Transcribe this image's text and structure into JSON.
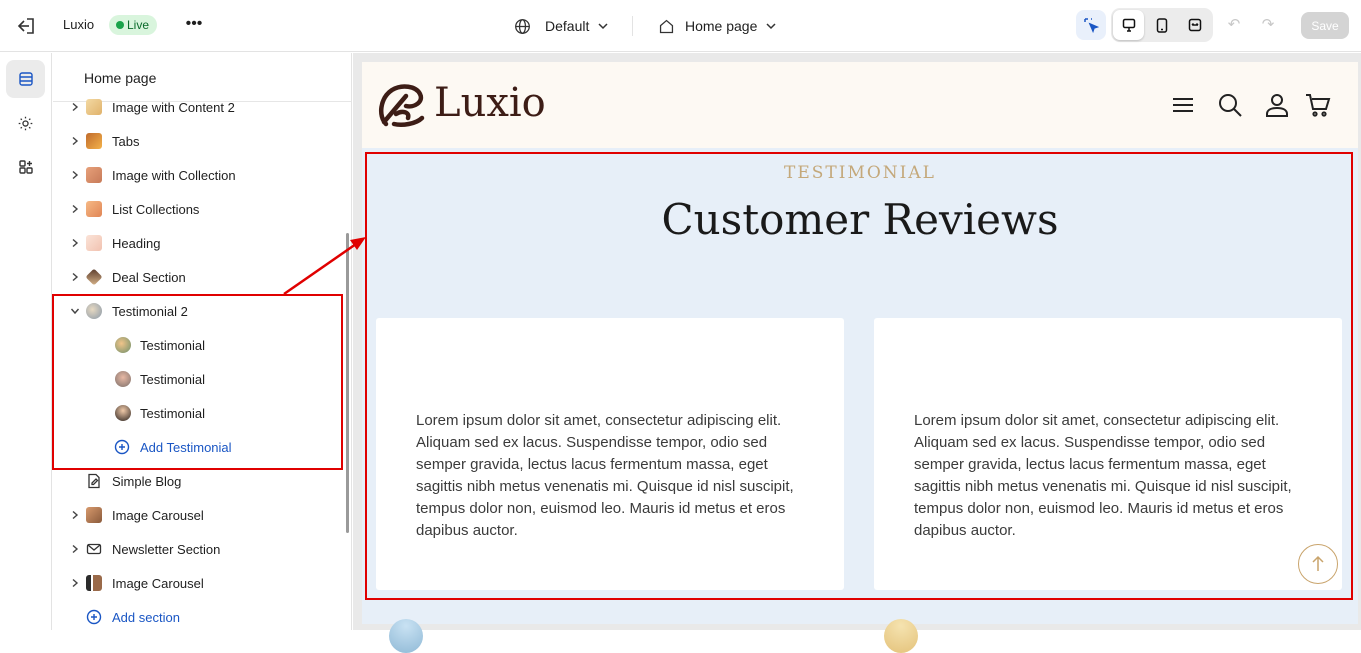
{
  "topbar": {
    "store_name": "Luxio",
    "status": "Live",
    "more": "•••",
    "theme": "Default",
    "page": "Home page",
    "undo": "↶",
    "redo": "↷",
    "save_label": "Save"
  },
  "panel": {
    "title": "Home page",
    "items": [
      {
        "label": "Image with Content 2"
      },
      {
        "label": "Tabs"
      },
      {
        "label": "Image with Collection"
      },
      {
        "label": "List Collections"
      },
      {
        "label": "Heading"
      },
      {
        "label": "Deal Section"
      },
      {
        "label": "Testimonial 2",
        "children": [
          {
            "label": "Testimonial"
          },
          {
            "label": "Testimonial"
          },
          {
            "label": "Testimonial"
          }
        ],
        "add_child": "Add Testimonial"
      },
      {
        "label": "Simple Blog"
      },
      {
        "label": "Image Carousel"
      },
      {
        "label": "Newsletter Section"
      },
      {
        "label": "Image Carousel"
      }
    ],
    "add_section": "Add section"
  },
  "preview": {
    "logo_text": "Luxio",
    "eyebrow": "TESTIMONIAL",
    "heading": "Customer Reviews",
    "cards": [
      {
        "text": "Lorem ipsum dolor sit amet, consectetur adipiscing elit. Aliquam sed ex lacus. Suspendisse tempor, odio sed semper gravida, lectus lacus fermentum massa, eget sagittis nibh metus venenatis mi. Quisque id nisl suscipit, tempus dolor non, euismod leo. Mauris id metus et eros dapibus auctor."
      },
      {
        "text": "Lorem ipsum dolor sit amet, consectetur adipiscing elit. Aliquam sed ex lacus. Suspendisse tempor, odio sed semper gravida, lectus lacus fermentum massa, eget sagittis nibh metus venenatis mi. Quisque id nisl suscipit, tempus dolor non, euismod leo. Mauris id metus et eros dapibus auctor."
      }
    ]
  },
  "colors": {
    "accent": "#1a56c4",
    "highlight": "#e00000",
    "brand": "#3d1d16",
    "gold": "#c4a87a"
  }
}
